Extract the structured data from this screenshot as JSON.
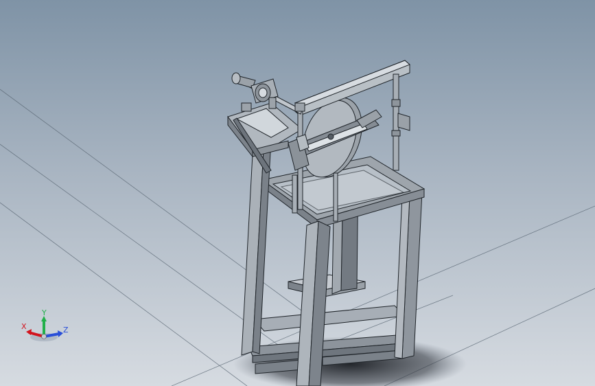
{
  "viewport": {
    "name": "graphics-area",
    "model": "frame-assembly"
  },
  "triad": {
    "x_label": "X",
    "y_label": "Y",
    "z_label": "Z",
    "x_color": "#d2141e",
    "y_color": "#22b04a",
    "z_color": "#2a4fd8"
  }
}
